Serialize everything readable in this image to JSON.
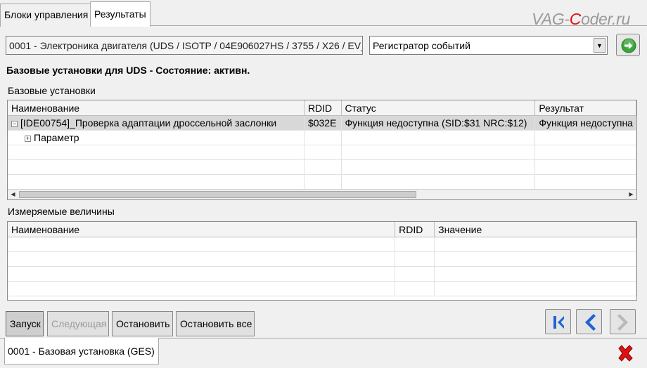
{
  "tabs": [
    {
      "label": "Блоки управления",
      "active": false
    },
    {
      "label": "Результаты",
      "active": true
    }
  ],
  "watermark": {
    "part1": "VAG-",
    "accent": "C",
    "part2": "oder.ru"
  },
  "ecu_field": {
    "value": "0001 - Электроника двигателя  (UDS / ISOTP / 04E906027HS / 3755 / X26 / EV_"
  },
  "dropdown": {
    "selected": "Регистратор событий"
  },
  "status_title": "Базовые установки для UDS - Состояние: активн.",
  "basic_settings": {
    "label": "Базовые установки",
    "columns": [
      "Наименование",
      "RDID",
      "Статус",
      "Результат"
    ],
    "rows": [
      {
        "toggle": "−",
        "name": "[IDE00754]_Проверка адаптации дроссельной заслонки",
        "rdid": "$032E",
        "status": "Функция недоступна (SID:$31 NRC:$12)",
        "result": "Функция недоступна"
      },
      {
        "toggle": "+",
        "name": "Параметр",
        "rdid": "",
        "status": "",
        "result": ""
      }
    ]
  },
  "measured_values": {
    "label": "Измеряемые величины",
    "columns": [
      "Наименование",
      "RDID",
      "Значение"
    ]
  },
  "buttons": {
    "start": "Запуск",
    "next": "Следующая",
    "stop": "Остановить",
    "stop_all": "Остановить все"
  },
  "bottom_tab": {
    "label": "0001 - Базовая установка (GES)"
  },
  "icons": {
    "go": "green-arrow-right-icon",
    "first": "skip-to-first-icon",
    "prev": "arrow-left-icon",
    "next": "arrow-right-icon",
    "close": "red-x-close-icon"
  },
  "colors": {
    "accent_red": "#dd1111",
    "go_green": "#3aa53a",
    "nav_blue": "#1e64d2"
  }
}
